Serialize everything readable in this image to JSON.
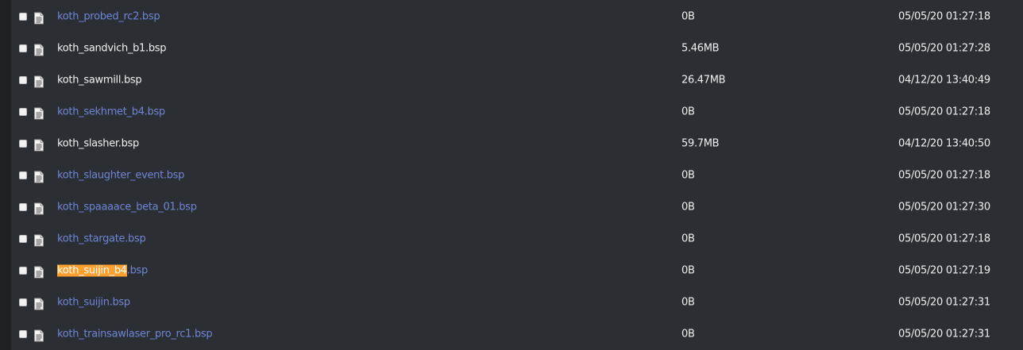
{
  "colors": {
    "background": "#2b2e33",
    "link": "#6f86d6",
    "text": "#f2f2f2",
    "highlight": "#ff9f2e"
  },
  "icons": {
    "file": "document-icon"
  },
  "files": [
    {
      "name": "koth_probed_rc2.bsp",
      "highlight": "",
      "rest": "koth_probed_rc2.bsp",
      "size": "0B",
      "date": "05/05/20 01:27:18",
      "style": "link"
    },
    {
      "name": "koth_sandvich_b1.bsp",
      "highlight": "",
      "rest": "koth_sandvich_b1.bsp",
      "size": "5.46MB",
      "date": "05/05/20 01:27:28",
      "style": "plain"
    },
    {
      "name": "koth_sawmill.bsp",
      "highlight": "",
      "rest": "koth_sawmill.bsp",
      "size": "26.47MB",
      "date": "04/12/20 13:40:49",
      "style": "plain"
    },
    {
      "name": "koth_sekhmet_b4.bsp",
      "highlight": "",
      "rest": "koth_sekhmet_b4.bsp",
      "size": "0B",
      "date": "05/05/20 01:27:18",
      "style": "link"
    },
    {
      "name": "koth_slasher.bsp",
      "highlight": "",
      "rest": "koth_slasher.bsp",
      "size": "59.7MB",
      "date": "04/12/20 13:40:50",
      "style": "plain"
    },
    {
      "name": "koth_slaughter_event.bsp",
      "highlight": "",
      "rest": "koth_slaughter_event.bsp",
      "size": "0B",
      "date": "05/05/20 01:27:18",
      "style": "link"
    },
    {
      "name": "koth_spaaaace_beta_01.bsp",
      "highlight": "",
      "rest": "koth_spaaaace_beta_01.bsp",
      "size": "0B",
      "date": "05/05/20 01:27:30",
      "style": "link"
    },
    {
      "name": "koth_stargate.bsp",
      "highlight": "",
      "rest": "koth_stargate.bsp",
      "size": "0B",
      "date": "05/05/20 01:27:18",
      "style": "link"
    },
    {
      "name": "koth_suijin_b4.bsp",
      "highlight": "koth_suijin_b4",
      "rest": ".bsp",
      "size": "0B",
      "date": "05/05/20 01:27:19",
      "style": "link"
    },
    {
      "name": "koth_suijin.bsp",
      "highlight": "",
      "rest": "koth_suijin.bsp",
      "size": "0B",
      "date": "05/05/20 01:27:31",
      "style": "link"
    },
    {
      "name": "koth_trainsawlaser_pro_rc1.bsp",
      "highlight": "",
      "rest": "koth_trainsawlaser_pro_rc1.bsp",
      "size": "0B",
      "date": "05/05/20 01:27:31",
      "style": "link"
    }
  ]
}
